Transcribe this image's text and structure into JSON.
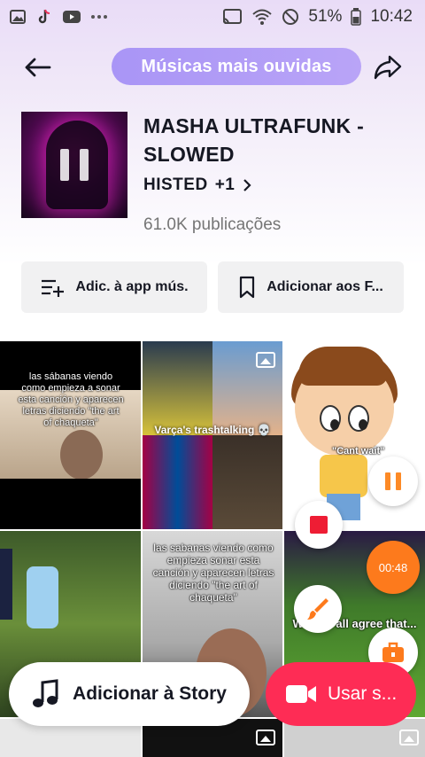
{
  "status_bar": {
    "battery": "51%",
    "time": "10:42",
    "icons": [
      "photos-icon",
      "tiktok-icon",
      "youtube-icon",
      "more-dots-icon",
      "cast-icon",
      "wifi-icon",
      "dnd-icon",
      "battery-icon"
    ]
  },
  "header": {
    "title": "Músicas mais ouvidas",
    "back_icon": "back-arrow-icon",
    "share_icon": "share-arrow-icon"
  },
  "song": {
    "title": "MASHA ULTRAFUNK - SLOWED",
    "artist": "HISTED",
    "more_artists": "+1",
    "publications": "61.0K publicações"
  },
  "actions": {
    "add_app": "Adic. à app mús.",
    "add_fav": "Adicionar aos F..."
  },
  "grid": {
    "c1_text": "las sábanas viendo como empieza a sonar esta canción y aparecen letras diciendo \"the art of chaqueta\"",
    "c2_caption": "Varça's trashtalking 💀",
    "c3_caption": "\"Cant wait\"",
    "c5_text": "las sabanas viendo como empieza  sonar esta canción  y aparecen letras diciendo \"the art of chaqueta\"",
    "c6_text": "We can all agree that..."
  },
  "overlay": {
    "timer": "00:48"
  },
  "bottom": {
    "story": "Adicionar à Story",
    "use": "Usar s..."
  },
  "colors": {
    "accent_pill": "#a995f6",
    "primary_red": "#fe2c55",
    "timer_orange": "#fd7a1c",
    "stop_red": "#ee1d34"
  }
}
